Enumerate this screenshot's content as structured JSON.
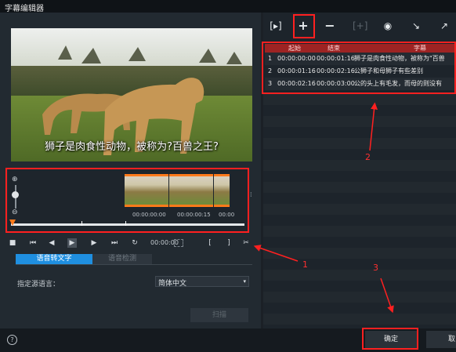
{
  "window": {
    "title": "字幕编辑器"
  },
  "video": {
    "caption": "狮子是肉食性动物，被称为?百兽之王?"
  },
  "timeline": {
    "timecodes": [
      "00:00:00:00",
      "00:00:00:15",
      "00:00"
    ],
    "current_time": "00:00:00",
    "playhead": 0
  },
  "tabs": {
    "speech_to_text": "语音转文字",
    "voice_detect": "语音检测"
  },
  "speech": {
    "language_label": "指定源语言：",
    "language_value": "简体中文",
    "scan_button": "扫描"
  },
  "table": {
    "headers": {
      "start": "起始",
      "end": "结束",
      "subtitle": "字幕"
    },
    "rows": [
      {
        "index": "1",
        "start": "00:00:00:00",
        "end": "00:00:01:16",
        "text": "狮子是肉食性动物，被称为\"百兽"
      },
      {
        "index": "2",
        "start": "00:00:01:16",
        "end": "00:00:02:16",
        "text": "公狮子和母狮子有些差别"
      },
      {
        "index": "3",
        "start": "00:00:02:16",
        "end": "00:00:03:00",
        "text": "公的头上有毛发，而母的则没有"
      }
    ]
  },
  "annotations": {
    "n1": "1",
    "n2": "2",
    "n3": "3"
  },
  "footer": {
    "ok": "确定",
    "cancel": "取"
  },
  "colors": {
    "annotation": "#ff2020",
    "table_header": "#9d2323",
    "tab_active": "#1f8fe0",
    "accent_orange": "#ff7a1a"
  },
  "icons": {
    "add": "plus-icon",
    "remove": "minus-icon",
    "help": "question-icon"
  }
}
